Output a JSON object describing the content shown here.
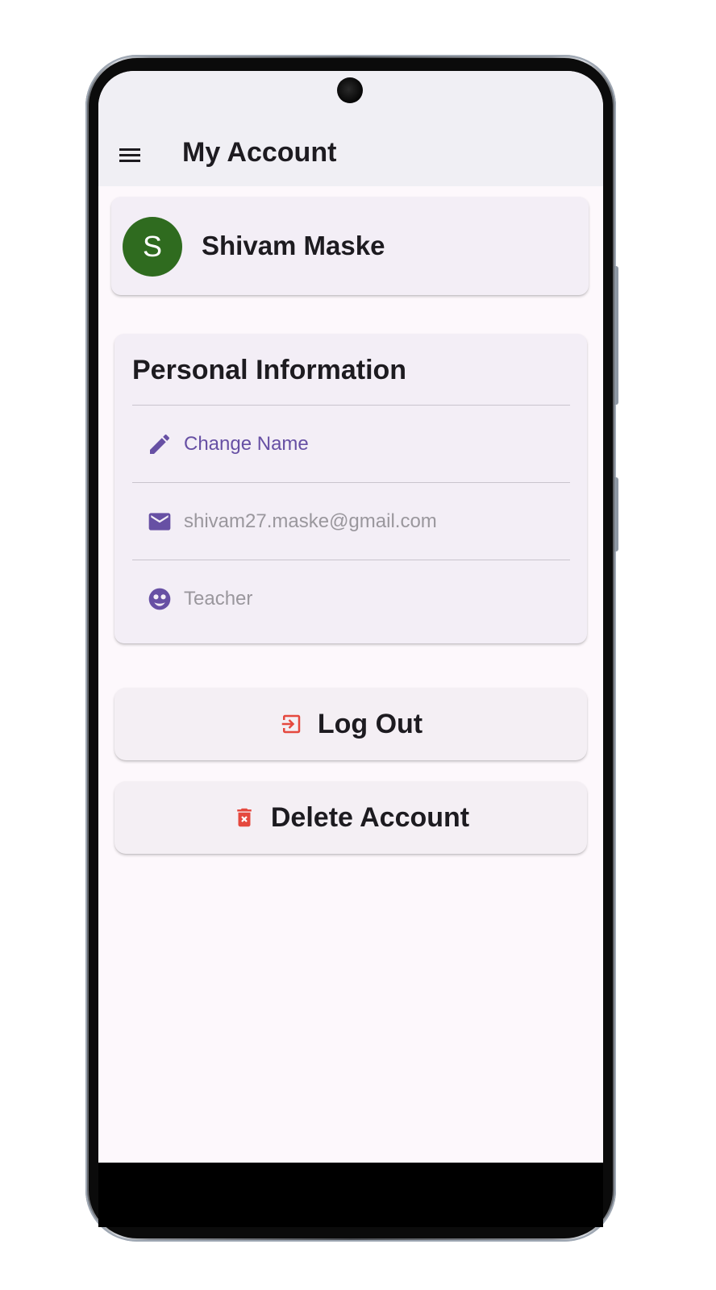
{
  "app_bar": {
    "title": "My Account"
  },
  "profile": {
    "avatar_initial": "S",
    "name": "Shivam Maske"
  },
  "personal_info": {
    "title": "Personal Information",
    "rows": [
      {
        "icon": "pencil-icon",
        "label": "Change Name"
      },
      {
        "icon": "email-icon",
        "label": "shivam27.maske@gmail.com"
      },
      {
        "icon": "face-icon",
        "label": "Teacher"
      }
    ]
  },
  "actions": {
    "logout_label": "Log Out",
    "delete_label": "Delete Account"
  },
  "colors": {
    "accent": "#6750a4",
    "avatar": "#2f6b1f",
    "danger": "#e5483e",
    "card": "#f3eef6",
    "background": "#fdf8fc"
  }
}
